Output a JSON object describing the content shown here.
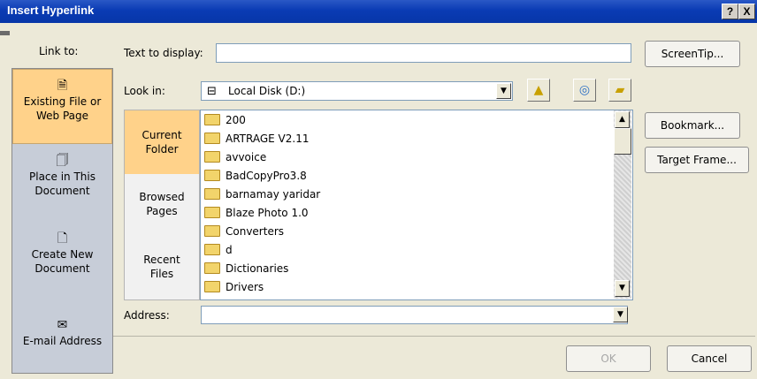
{
  "window": {
    "title": "Insert Hyperlink",
    "help": "?",
    "close": "X"
  },
  "link_to": {
    "label": "Link to:",
    "items": [
      {
        "label_l1": "Existing File or",
        "label_l2": "Web Page",
        "selected": true,
        "icon": "globe-file-icon"
      },
      {
        "label_l1": "Place in This",
        "label_l2": "Document",
        "selected": false,
        "icon": "document-place-icon"
      },
      {
        "label_l1": "Create New",
        "label_l2": "Document",
        "selected": false,
        "icon": "new-document-icon"
      },
      {
        "label_l1": "E-mail Address",
        "label_l2": "",
        "selected": false,
        "icon": "email-icon"
      }
    ]
  },
  "text_to_display": {
    "label": "Text to display:",
    "value": ""
  },
  "buttons": {
    "screentip": "ScreenTip...",
    "bookmark": "Bookmark...",
    "target_frame": "Target Frame...",
    "ok": "OK",
    "cancel": "Cancel"
  },
  "look_in": {
    "label": "Look in:",
    "value": "Local Disk  (D:)"
  },
  "tabs": [
    {
      "l1": "Current",
      "l2": "Folder",
      "selected": true
    },
    {
      "l1": "Browsed",
      "l2": "Pages",
      "selected": false
    },
    {
      "l1": "Recent",
      "l2": "Files",
      "selected": false
    }
  ],
  "files": [
    "200",
    "ARTRAGE V2.11",
    "avvoice",
    "BadCopyPro3.8",
    "barnamay yaridar",
    "Blaze Photo 1.0",
    "Converters",
    "d",
    "Dictionaries",
    "Drivers"
  ],
  "address": {
    "label": "Address:",
    "value": ""
  }
}
